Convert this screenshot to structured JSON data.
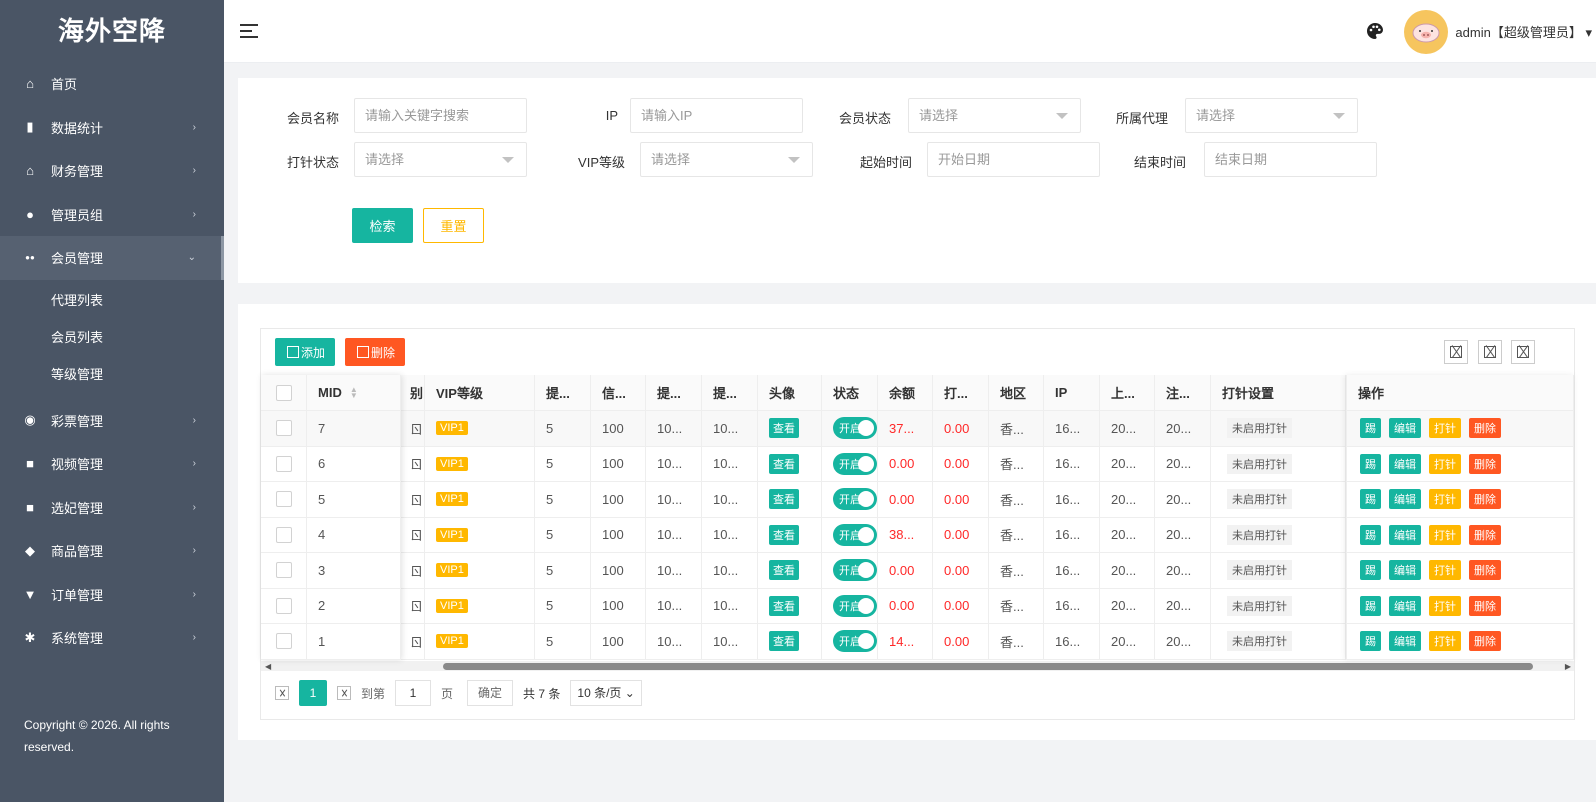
{
  "app": {
    "title": "海外空降"
  },
  "sidebar": {
    "items": [
      {
        "label": "首页",
        "icon": "home-icon",
        "arrow": ""
      },
      {
        "label": "数据统计",
        "icon": "bar-chart-icon",
        "arrow": "›"
      },
      {
        "label": "财务管理",
        "icon": "bank-icon",
        "arrow": "›"
      },
      {
        "label": "管理员组",
        "icon": "user-icon",
        "arrow": "›"
      },
      {
        "label": "会员管理",
        "icon": "users-icon",
        "arrow": "⌄"
      },
      {
        "label": "彩票管理",
        "icon": "gamepad-icon",
        "arrow": "›"
      },
      {
        "label": "视频管理",
        "icon": "video-icon",
        "arrow": "›"
      },
      {
        "label": "选妃管理",
        "icon": "video-icon",
        "arrow": "›"
      },
      {
        "label": "商品管理",
        "icon": "cube-icon",
        "arrow": "›"
      },
      {
        "label": "订单管理",
        "icon": "cart-icon",
        "arrow": "›"
      },
      {
        "label": "系统管理",
        "icon": "gear-icon",
        "arrow": "›"
      }
    ],
    "sub_items": [
      "代理列表",
      "会员列表",
      "等级管理"
    ],
    "copyright": "Copyright © 2026. All rights reserved."
  },
  "header": {
    "user": "admin【超级管理员】",
    "user_caret": "▾"
  },
  "search": {
    "member_name_label": "会员名称",
    "member_name_placeholder": "请输入关键字搜索",
    "ip_label": "IP",
    "ip_placeholder": "请输入IP",
    "status_label": "会员状态",
    "status_placeholder": "请选择",
    "agent_label": "所属代理",
    "agent_placeholder": "请选择",
    "clock_label": "打针状态",
    "clock_placeholder": "请选择",
    "vip_label": "VIP等级",
    "vip_placeholder": "请选择",
    "start_label": "起始时间",
    "start_placeholder": "开始日期",
    "end_label": "结束时间",
    "end_placeholder": "结束日期",
    "search_button": "检索",
    "reset_button": "重置"
  },
  "toolbar": {
    "add_label": "添加",
    "delete_label": "删除"
  },
  "table": {
    "headers": [
      "MID",
      "别",
      "VIP等级",
      "提...",
      "信...",
      "提...",
      "提...",
      "头像",
      "状态",
      "余额",
      "打...",
      "地区",
      "IP",
      "上...",
      "注...",
      "打针设置",
      "操作"
    ],
    "rows": [
      {
        "mid": "7",
        "g": "ㄖ",
        "vip": "VIP1",
        "c1": "5",
        "c2": "100",
        "c3": "10...",
        "c4": "10...",
        "avatar": "查看",
        "status": "开启",
        "balance": "37...",
        "clock": "0.00",
        "region": "香...",
        "ip": "16...",
        "last": "20...",
        "reg": "20...",
        "pin": "未启用打针"
      },
      {
        "mid": "6",
        "g": "ㄖ",
        "vip": "VIP1",
        "c1": "5",
        "c2": "100",
        "c3": "10...",
        "c4": "10...",
        "avatar": "查看",
        "status": "开启",
        "balance": "0.00",
        "clock": "0.00",
        "region": "香...",
        "ip": "16...",
        "last": "20...",
        "reg": "20...",
        "pin": "未启用打针"
      },
      {
        "mid": "5",
        "g": "ㄖ",
        "vip": "VIP1",
        "c1": "5",
        "c2": "100",
        "c3": "10...",
        "c4": "10...",
        "avatar": "查看",
        "status": "开启",
        "balance": "0.00",
        "clock": "0.00",
        "region": "香...",
        "ip": "16...",
        "last": "20...",
        "reg": "20...",
        "pin": "未启用打针"
      },
      {
        "mid": "4",
        "g": "ㄖ",
        "vip": "VIP1",
        "c1": "5",
        "c2": "100",
        "c3": "10...",
        "c4": "10...",
        "avatar": "查看",
        "status": "开启",
        "balance": "38...",
        "clock": "0.00",
        "region": "香...",
        "ip": "16...",
        "last": "20...",
        "reg": "20...",
        "pin": "未启用打针"
      },
      {
        "mid": "3",
        "g": "ㄖ",
        "vip": "VIP1",
        "c1": "5",
        "c2": "100",
        "c3": "10...",
        "c4": "10...",
        "avatar": "查看",
        "status": "开启",
        "balance": "0.00",
        "clock": "0.00",
        "region": "香...",
        "ip": "16...",
        "last": "20...",
        "reg": "20...",
        "pin": "未启用打针"
      },
      {
        "mid": "2",
        "g": "ㄖ",
        "vip": "VIP1",
        "c1": "5",
        "c2": "100",
        "c3": "10...",
        "c4": "10...",
        "avatar": "查看",
        "status": "开启",
        "balance": "0.00",
        "clock": "0.00",
        "region": "香...",
        "ip": "16...",
        "last": "20...",
        "reg": "20...",
        "pin": "未启用打针"
      },
      {
        "mid": "1",
        "g": "ㄖ",
        "vip": "VIP1",
        "c1": "5",
        "c2": "100",
        "c3": "10...",
        "c4": "10...",
        "avatar": "查看",
        "status": "开启",
        "balance": "14...",
        "clock": "0.00",
        "region": "香...",
        "ip": "16...",
        "last": "20...",
        "reg": "20...",
        "pin": "未启用打针"
      }
    ],
    "ops": [
      "踢",
      "编辑",
      "打针",
      "删除"
    ]
  },
  "pager": {
    "current": "1",
    "goto_label": "到第",
    "goto_value": "1",
    "page_unit": "页",
    "confirm": "确定",
    "total": "共 7 条",
    "per_page": "10 条/页"
  },
  "colors": {
    "sidebar": "#4a5565",
    "accent": "#16b5a0",
    "warn": "#ffb800",
    "danger": "#ff5722",
    "red_text": "#ff2828"
  }
}
